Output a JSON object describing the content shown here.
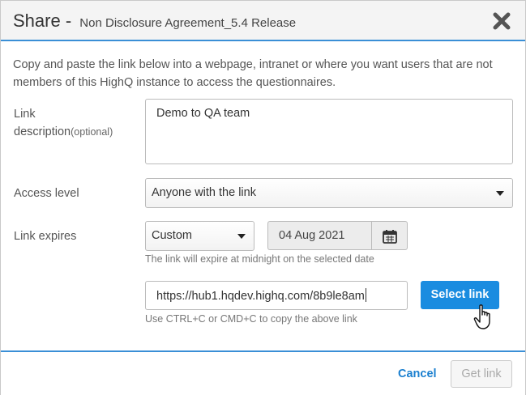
{
  "header": {
    "title": "Share",
    "separator": "-",
    "subtitle": "Non Disclosure Agreement_5.4 Release",
    "close_icon": "close-icon"
  },
  "intro": "Copy and paste the link below into a webpage, intranet or where you want users that are not members of this HighQ instance to access the questionnaires.",
  "fields": {
    "link_description": {
      "label": "Link description",
      "optional": "(optional)",
      "value": "Demo to QA team"
    },
    "access_level": {
      "label": "Access level",
      "value": "Anyone with the link"
    },
    "link_expires": {
      "label": "Link expires",
      "mode": "Custom",
      "date": "04 Aug 2021",
      "hint": "The link will expire at midnight on the selected date",
      "calendar_icon": "calendar-icon"
    },
    "link": {
      "url": "https://hub1.hqdev.highq.com/8b9le8am",
      "hint": "Use CTRL+C or CMD+C to copy the above link",
      "select_label": "Select link"
    }
  },
  "footer": {
    "cancel_label": "Cancel",
    "getlink_label": "Get link"
  },
  "colors": {
    "accent": "#1a8ce0",
    "divider": "#3a8fd6",
    "link_text": "#1a7fcf"
  }
}
